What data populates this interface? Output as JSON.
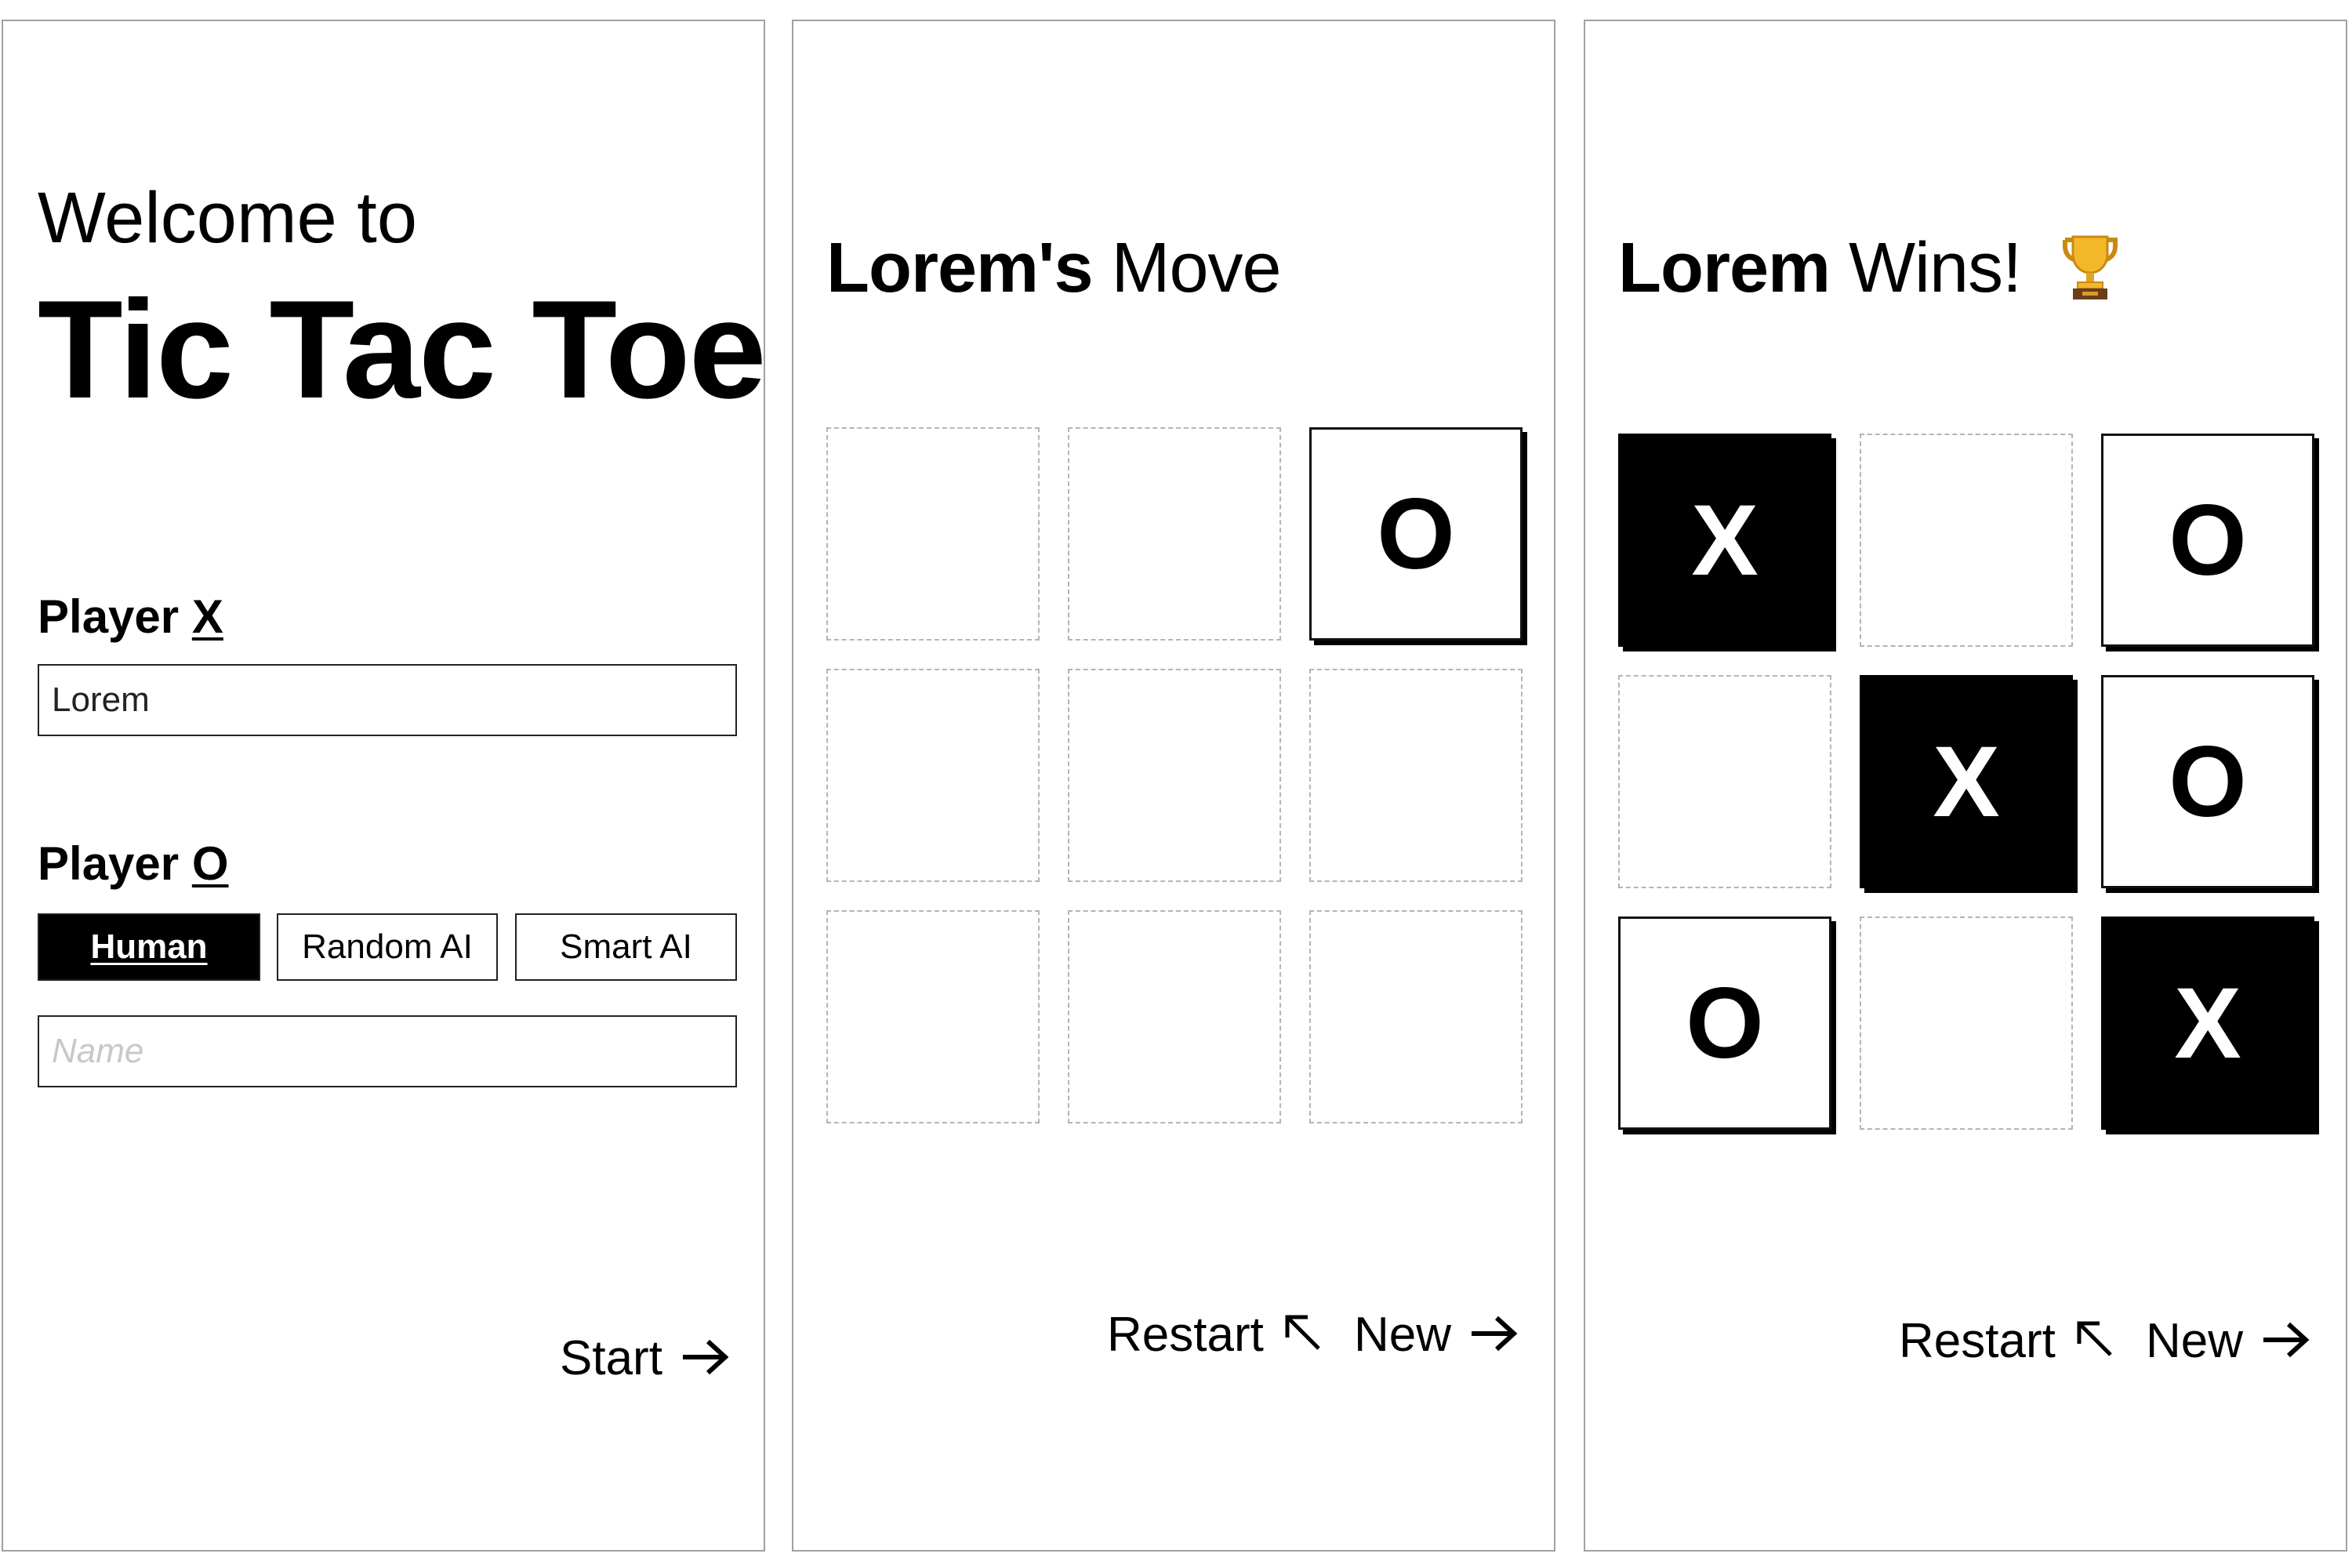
{
  "setup_screen": {
    "welcome_line": "Welcome to",
    "game_title": "Tic Tac Toe",
    "player_x": {
      "label": "Player",
      "mark": "X",
      "name_value": "Lorem"
    },
    "player_o": {
      "label": "Player",
      "mark": "O",
      "name_placeholder": "Name",
      "types": [
        "Human",
        "Random AI",
        "Smart AI"
      ],
      "selected_type": "Human"
    },
    "start_label": "Start",
    "start_icon": "arrow-right-icon"
  },
  "game_screen": {
    "player_name": "Lorem's",
    "status_suffix": "Move",
    "board": [
      "",
      "",
      "O",
      "",
      "",
      "",
      "",
      "",
      ""
    ],
    "restart_label": "Restart",
    "restart_icon": "arrow-up-left-icon",
    "new_label": "New",
    "new_icon": "arrow-right-icon"
  },
  "win_screen": {
    "winner_name": "Lorem",
    "status_suffix": "Wins!",
    "trophy_icon": "trophy-icon",
    "board": [
      "X",
      "",
      "O",
      "",
      "X",
      "O",
      "O",
      "",
      "X"
    ],
    "winning_cells": [
      0,
      4,
      8
    ],
    "restart_label": "Restart",
    "restart_icon": "arrow-up-left-icon",
    "new_label": "New",
    "new_icon": "arrow-right-icon"
  },
  "colors": {
    "mark_o_bg": "#ffffff",
    "mark_x_bg": "#000000",
    "empty_border": "#b5b5b5",
    "panel_border": "#a0a0a0"
  }
}
